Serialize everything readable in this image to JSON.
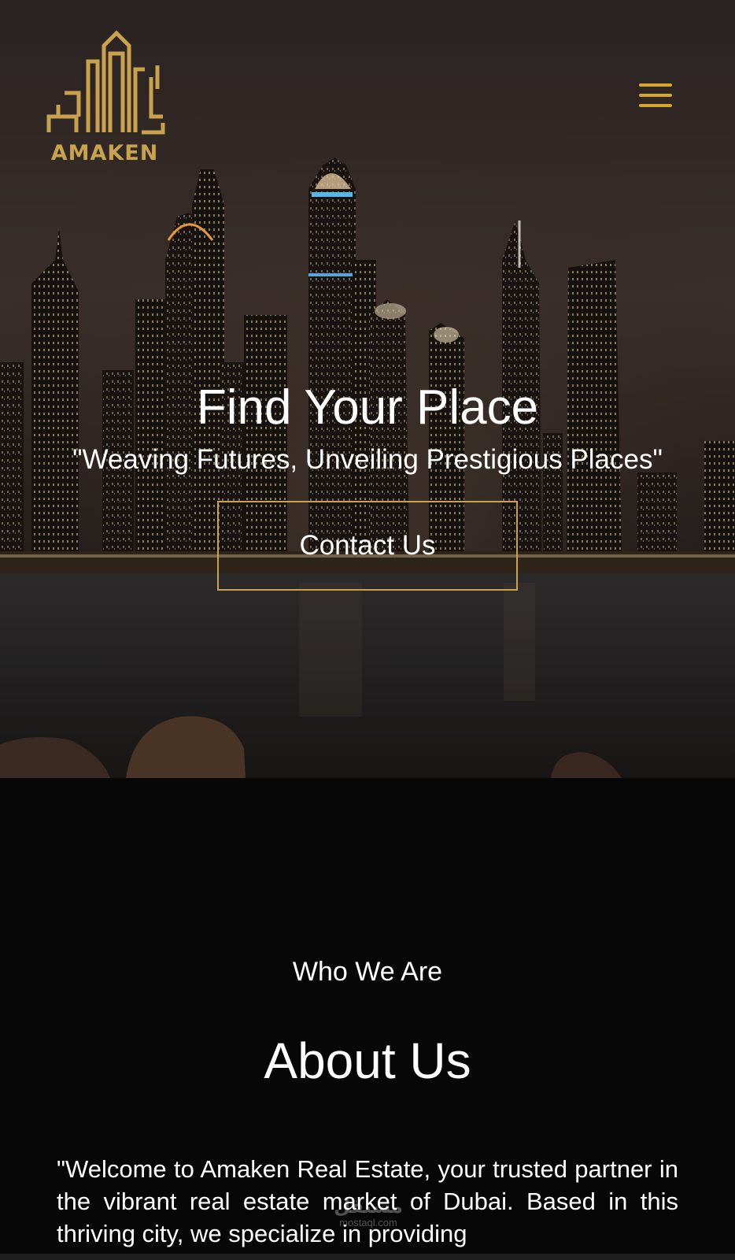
{
  "brand": {
    "logo_text": "AMAKEN",
    "logo_arabic": "أماكن",
    "accent_color": "#c9a24d"
  },
  "header": {
    "menu_icon": "hamburger-menu-icon"
  },
  "hero": {
    "title": "Find Your Place",
    "subtitle": "\"Weaving Futures, Unveiling Prestigious Places\"",
    "cta_label": "Contact Us"
  },
  "about": {
    "eyebrow": "Who We Are",
    "title": "About Us",
    "body": "\"Welcome to Amaken Real Estate, your trusted partner in the vibrant real estate market of Dubai. Based in this thriving city, we specialize in providing"
  },
  "watermark": {
    "logo": "مستقل",
    "url": "mostaql.com"
  }
}
